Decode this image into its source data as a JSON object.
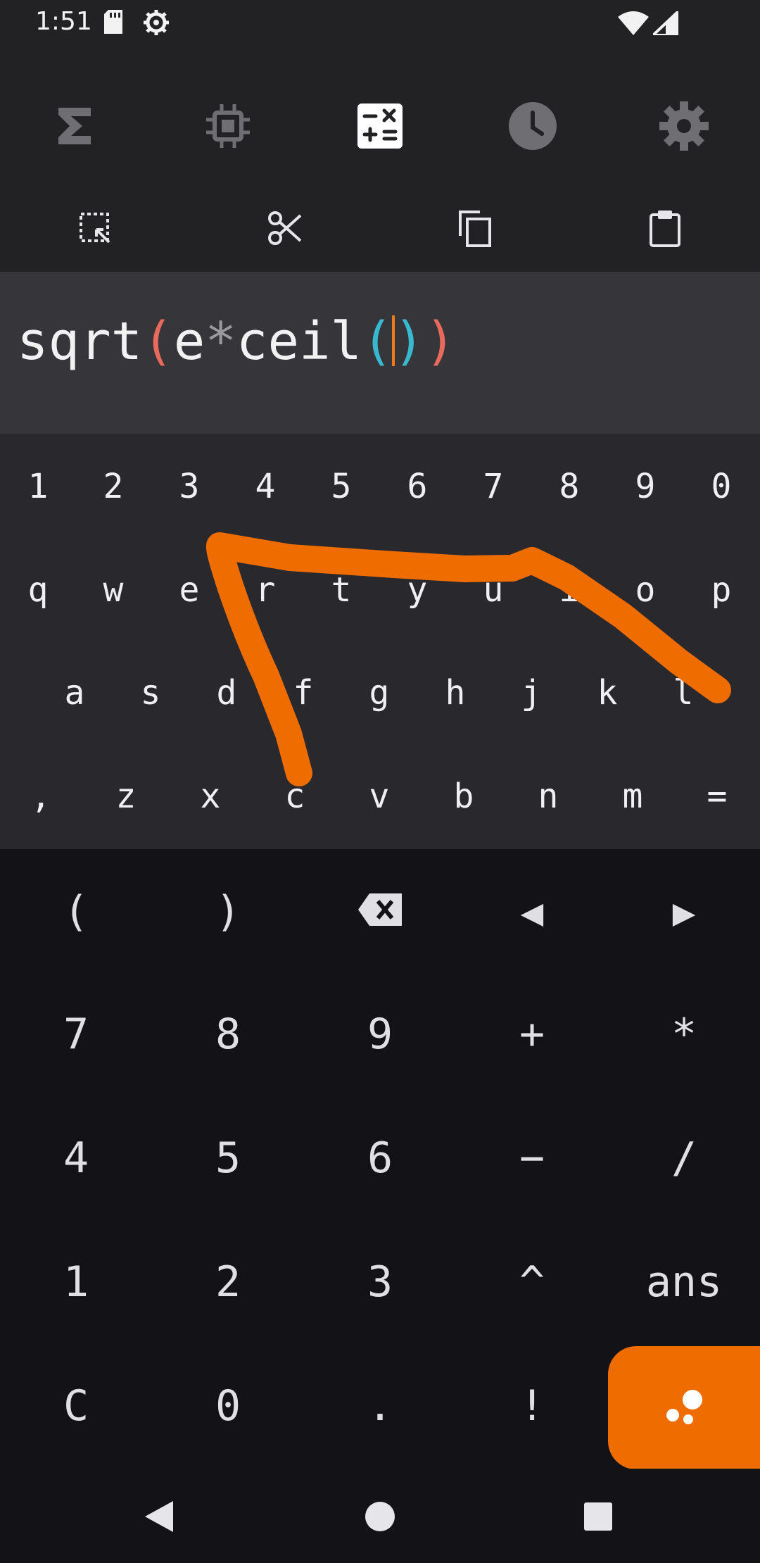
{
  "status": {
    "time": "1:51",
    "icons": [
      "sd-card-icon",
      "settings-sync-icon",
      "wifi-icon",
      "signal-icon"
    ]
  },
  "tabs": [
    {
      "name": "sigma-icon",
      "active": false
    },
    {
      "name": "chip-icon",
      "active": false
    },
    {
      "name": "calculator-icon",
      "active": true
    },
    {
      "name": "history-icon",
      "active": false
    },
    {
      "name": "settings-gear-icon",
      "active": false
    }
  ],
  "toolbar": [
    "select-all-icon",
    "cut-icon",
    "copy-icon",
    "paste-icon"
  ],
  "expression": {
    "tokens": [
      "sqrt",
      "(",
      "e",
      "*",
      "ceil",
      "(",
      ")",
      ")"
    ]
  },
  "letters": {
    "row1": [
      "1",
      "2",
      "3",
      "4",
      "5",
      "6",
      "7",
      "8",
      "9",
      "0"
    ],
    "row2": [
      "q",
      "w",
      "e",
      "r",
      "t",
      "y",
      "u",
      "i",
      "o",
      "p"
    ],
    "row3": [
      "a",
      "s",
      "d",
      "f",
      "g",
      "h",
      "j",
      "k",
      "l"
    ],
    "row4": [
      ",",
      "z",
      "x",
      "c",
      "v",
      "b",
      "n",
      "m",
      "="
    ]
  },
  "numpad": {
    "row1": [
      "(",
      ")",
      "backspace",
      "◀",
      "▶"
    ],
    "row2": [
      "7",
      "8",
      "9",
      "+",
      "*"
    ],
    "row3": [
      "4",
      "5",
      "6",
      "−",
      "/"
    ],
    "row4": [
      "1",
      "2",
      "3",
      "^",
      "ans"
    ],
    "row5": [
      "C",
      "0",
      ".",
      "!"
    ]
  },
  "equals_icon": "graph-nodes-icon",
  "colors": {
    "accent": "#ef6c00",
    "caret": "#ef7a1c",
    "paren_outer": "#e86a5c",
    "paren_inner": "#39b9d0"
  }
}
